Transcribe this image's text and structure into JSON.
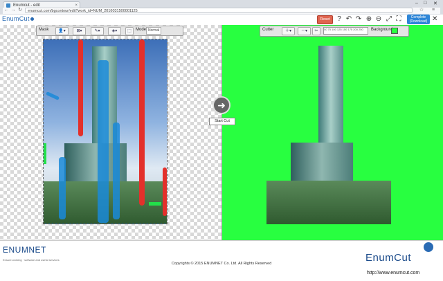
{
  "browser": {
    "tab_title": "Enumcut - edit",
    "url": "enumcut.com/bgcontour/edit?work_id=NUM_2016031500001125",
    "close_glyph": "×"
  },
  "app": {
    "logo": "EnumCut",
    "reset_label": "Reset",
    "complete_label_1": "Complete",
    "complete_label_2": "(Download)"
  },
  "mask_toolbar": {
    "label": "Mask",
    "mode_label": "Mode",
    "mode_value": "Normal"
  },
  "cutout_toolbar": {
    "label": "Cutter",
    "ruler_ticks": "50 75 100 125 150 175 200 250",
    "background_label": "Background",
    "background_color": "#28ff40"
  },
  "start_cut": {
    "label": "Start Cut",
    "icon": "arrow-right-icon"
  },
  "footer": {
    "brand_left": "ENUMNET",
    "tagline": "Ensure working · software and useful services",
    "copyright": "Copyrights © 2015 ENUMNET Co. Ltd. All Rights Reserved",
    "brand_right": "EnumCut",
    "website": "http://www.enumcut.com"
  },
  "colors": {
    "mask_red": "#e3302b",
    "mask_blue": "#1a8ad8",
    "mask_green": "#22e04a",
    "reset_button": "#e0644f",
    "complete_button": "#2e86d8"
  }
}
